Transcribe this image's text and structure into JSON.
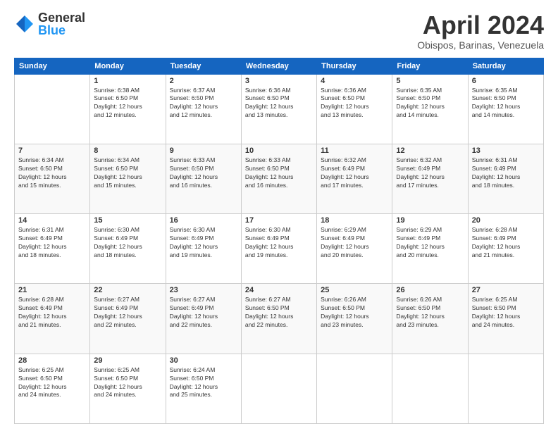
{
  "logo": {
    "general": "General",
    "blue": "Blue"
  },
  "title": "April 2024",
  "location": "Obispos, Barinas, Venezuela",
  "days_header": [
    "Sunday",
    "Monday",
    "Tuesday",
    "Wednesday",
    "Thursday",
    "Friday",
    "Saturday"
  ],
  "weeks": [
    [
      {
        "day": "",
        "info": ""
      },
      {
        "day": "1",
        "info": "Sunrise: 6:38 AM\nSunset: 6:50 PM\nDaylight: 12 hours\nand 12 minutes."
      },
      {
        "day": "2",
        "info": "Sunrise: 6:37 AM\nSunset: 6:50 PM\nDaylight: 12 hours\nand 12 minutes."
      },
      {
        "day": "3",
        "info": "Sunrise: 6:36 AM\nSunset: 6:50 PM\nDaylight: 12 hours\nand 13 minutes."
      },
      {
        "day": "4",
        "info": "Sunrise: 6:36 AM\nSunset: 6:50 PM\nDaylight: 12 hours\nand 13 minutes."
      },
      {
        "day": "5",
        "info": "Sunrise: 6:35 AM\nSunset: 6:50 PM\nDaylight: 12 hours\nand 14 minutes."
      },
      {
        "day": "6",
        "info": "Sunrise: 6:35 AM\nSunset: 6:50 PM\nDaylight: 12 hours\nand 14 minutes."
      }
    ],
    [
      {
        "day": "7",
        "info": "Sunrise: 6:34 AM\nSunset: 6:50 PM\nDaylight: 12 hours\nand 15 minutes."
      },
      {
        "day": "8",
        "info": "Sunrise: 6:34 AM\nSunset: 6:50 PM\nDaylight: 12 hours\nand 15 minutes."
      },
      {
        "day": "9",
        "info": "Sunrise: 6:33 AM\nSunset: 6:50 PM\nDaylight: 12 hours\nand 16 minutes."
      },
      {
        "day": "10",
        "info": "Sunrise: 6:33 AM\nSunset: 6:50 PM\nDaylight: 12 hours\nand 16 minutes."
      },
      {
        "day": "11",
        "info": "Sunrise: 6:32 AM\nSunset: 6:49 PM\nDaylight: 12 hours\nand 17 minutes."
      },
      {
        "day": "12",
        "info": "Sunrise: 6:32 AM\nSunset: 6:49 PM\nDaylight: 12 hours\nand 17 minutes."
      },
      {
        "day": "13",
        "info": "Sunrise: 6:31 AM\nSunset: 6:49 PM\nDaylight: 12 hours\nand 18 minutes."
      }
    ],
    [
      {
        "day": "14",
        "info": "Sunrise: 6:31 AM\nSunset: 6:49 PM\nDaylight: 12 hours\nand 18 minutes."
      },
      {
        "day": "15",
        "info": "Sunrise: 6:30 AM\nSunset: 6:49 PM\nDaylight: 12 hours\nand 18 minutes."
      },
      {
        "day": "16",
        "info": "Sunrise: 6:30 AM\nSunset: 6:49 PM\nDaylight: 12 hours\nand 19 minutes."
      },
      {
        "day": "17",
        "info": "Sunrise: 6:30 AM\nSunset: 6:49 PM\nDaylight: 12 hours\nand 19 minutes."
      },
      {
        "day": "18",
        "info": "Sunrise: 6:29 AM\nSunset: 6:49 PM\nDaylight: 12 hours\nand 20 minutes."
      },
      {
        "day": "19",
        "info": "Sunrise: 6:29 AM\nSunset: 6:49 PM\nDaylight: 12 hours\nand 20 minutes."
      },
      {
        "day": "20",
        "info": "Sunrise: 6:28 AM\nSunset: 6:49 PM\nDaylight: 12 hours\nand 21 minutes."
      }
    ],
    [
      {
        "day": "21",
        "info": "Sunrise: 6:28 AM\nSunset: 6:49 PM\nDaylight: 12 hours\nand 21 minutes."
      },
      {
        "day": "22",
        "info": "Sunrise: 6:27 AM\nSunset: 6:49 PM\nDaylight: 12 hours\nand 22 minutes."
      },
      {
        "day": "23",
        "info": "Sunrise: 6:27 AM\nSunset: 6:49 PM\nDaylight: 12 hours\nand 22 minutes."
      },
      {
        "day": "24",
        "info": "Sunrise: 6:27 AM\nSunset: 6:50 PM\nDaylight: 12 hours\nand 22 minutes."
      },
      {
        "day": "25",
        "info": "Sunrise: 6:26 AM\nSunset: 6:50 PM\nDaylight: 12 hours\nand 23 minutes."
      },
      {
        "day": "26",
        "info": "Sunrise: 6:26 AM\nSunset: 6:50 PM\nDaylight: 12 hours\nand 23 minutes."
      },
      {
        "day": "27",
        "info": "Sunrise: 6:25 AM\nSunset: 6:50 PM\nDaylight: 12 hours\nand 24 minutes."
      }
    ],
    [
      {
        "day": "28",
        "info": "Sunrise: 6:25 AM\nSunset: 6:50 PM\nDaylight: 12 hours\nand 24 minutes."
      },
      {
        "day": "29",
        "info": "Sunrise: 6:25 AM\nSunset: 6:50 PM\nDaylight: 12 hours\nand 24 minutes."
      },
      {
        "day": "30",
        "info": "Sunrise: 6:24 AM\nSunset: 6:50 PM\nDaylight: 12 hours\nand 25 minutes."
      },
      {
        "day": "",
        "info": ""
      },
      {
        "day": "",
        "info": ""
      },
      {
        "day": "",
        "info": ""
      },
      {
        "day": "",
        "info": ""
      }
    ]
  ]
}
